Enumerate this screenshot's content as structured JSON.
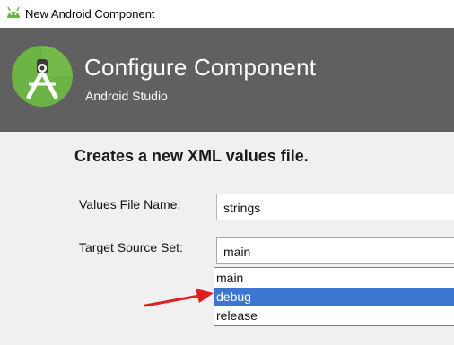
{
  "window": {
    "title": "New Android Component",
    "title_icon": "android-icon"
  },
  "banner": {
    "title": "Configure Component",
    "subtitle": "Android Studio",
    "logo": "android-studio-logo",
    "background": "#606060",
    "logo_color": "#6ab344"
  },
  "form": {
    "heading": "Creates a new XML values file.",
    "values_file_name": {
      "label": "Values File Name:",
      "value": "strings"
    },
    "target_source_set": {
      "label": "Target Source Set:",
      "value": "main",
      "options": [
        "main",
        "debug",
        "release"
      ],
      "highlighted": "debug"
    }
  },
  "annotation": {
    "type": "red-arrow",
    "color": "#e02020",
    "points_to": "debug"
  },
  "colors": {
    "selection": "#3d76d1",
    "window_bg": "#f0f0f0"
  }
}
